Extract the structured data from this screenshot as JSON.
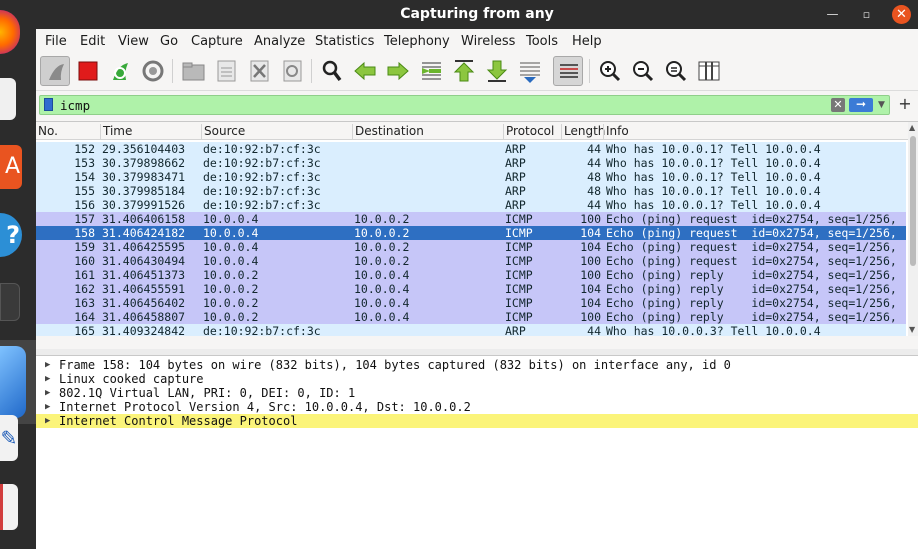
{
  "window": {
    "title": "Capturing from any"
  },
  "menu": [
    "File",
    "Edit",
    "View",
    "Go",
    "Capture",
    "Analyze",
    "Statistics",
    "Telephony",
    "Wireless",
    "Tools",
    "Help"
  ],
  "toolbar": {
    "icons": [
      "shark-fin-start-icon",
      "stop-capture-icon",
      "restart-capture-icon",
      "capture-options-icon",
      "open-file-icon",
      "save-file-icon",
      "close-file-icon",
      "reload-file-icon",
      "find-packet-icon",
      "go-back-icon",
      "go-forward-icon",
      "go-to-packet-icon",
      "go-first-packet-icon",
      "go-last-packet-icon",
      "autoscroll-icon",
      "colorize-icon",
      "zoom-in-icon",
      "zoom-out-icon",
      "normal-size-icon",
      "resize-columns-icon"
    ]
  },
  "filter": {
    "value": "icmp"
  },
  "columns": [
    "No.",
    "Time",
    "Source",
    "Destination",
    "Protocol",
    "Length",
    "Info"
  ],
  "packets": [
    {
      "no": "152",
      "time": "29.356104403",
      "src": "de:10:92:b7:cf:3c",
      "dst": "",
      "proto": "ARP",
      "len": "44",
      "info": "Who has 10.0.0.1? Tell 10.0.0.4",
      "kind": "arp"
    },
    {
      "no": "153",
      "time": "30.379898662",
      "src": "de:10:92:b7:cf:3c",
      "dst": "",
      "proto": "ARP",
      "len": "44",
      "info": "Who has 10.0.0.1? Tell 10.0.0.4",
      "kind": "arp"
    },
    {
      "no": "154",
      "time": "30.379983471",
      "src": "de:10:92:b7:cf:3c",
      "dst": "",
      "proto": "ARP",
      "len": "48",
      "info": "Who has 10.0.0.1? Tell 10.0.0.4",
      "kind": "arp"
    },
    {
      "no": "155",
      "time": "30.379985184",
      "src": "de:10:92:b7:cf:3c",
      "dst": "",
      "proto": "ARP",
      "len": "48",
      "info": "Who has 10.0.0.1? Tell 10.0.0.4",
      "kind": "arp"
    },
    {
      "no": "156",
      "time": "30.379991526",
      "src": "de:10:92:b7:cf:3c",
      "dst": "",
      "proto": "ARP",
      "len": "44",
      "info": "Who has 10.0.0.1? Tell 10.0.0.4",
      "kind": "arp"
    },
    {
      "no": "157",
      "time": "31.406406158",
      "src": "10.0.0.4",
      "dst": "10.0.0.2",
      "proto": "ICMP",
      "len": "100",
      "info": "Echo (ping) request  id=0x2754, seq=1/256,",
      "kind": "icmp"
    },
    {
      "no": "158",
      "time": "31.406424182",
      "src": "10.0.0.4",
      "dst": "10.0.0.2",
      "proto": "ICMP",
      "len": "104",
      "info": "Echo (ping) request  id=0x2754, seq=1/256,",
      "kind": "sel"
    },
    {
      "no": "159",
      "time": "31.406425595",
      "src": "10.0.0.4",
      "dst": "10.0.0.2",
      "proto": "ICMP",
      "len": "104",
      "info": "Echo (ping) request  id=0x2754, seq=1/256,",
      "kind": "icmp"
    },
    {
      "no": "160",
      "time": "31.406430494",
      "src": "10.0.0.4",
      "dst": "10.0.0.2",
      "proto": "ICMP",
      "len": "100",
      "info": "Echo (ping) request  id=0x2754, seq=1/256,",
      "kind": "icmp"
    },
    {
      "no": "161",
      "time": "31.406451373",
      "src": "10.0.0.2",
      "dst": "10.0.0.4",
      "proto": "ICMP",
      "len": "100",
      "info": "Echo (ping) reply    id=0x2754, seq=1/256,",
      "kind": "icmp"
    },
    {
      "no": "162",
      "time": "31.406455591",
      "src": "10.0.0.2",
      "dst": "10.0.0.4",
      "proto": "ICMP",
      "len": "104",
      "info": "Echo (ping) reply    id=0x2754, seq=1/256,",
      "kind": "icmp"
    },
    {
      "no": "163",
      "time": "31.406456402",
      "src": "10.0.0.2",
      "dst": "10.0.0.4",
      "proto": "ICMP",
      "len": "104",
      "info": "Echo (ping) reply    id=0x2754, seq=1/256,",
      "kind": "icmp"
    },
    {
      "no": "164",
      "time": "31.406458807",
      "src": "10.0.0.2",
      "dst": "10.0.0.4",
      "proto": "ICMP",
      "len": "100",
      "info": "Echo (ping) reply    id=0x2754, seq=1/256,",
      "kind": "icmp"
    },
    {
      "no": "165",
      "time": "31.409324842",
      "src": "de:10:92:b7:cf:3c",
      "dst": "",
      "proto": "ARP",
      "len": "44",
      "info": "Who has 10.0.0.3? Tell 10.0.0.4",
      "kind": "arp"
    }
  ],
  "details": [
    {
      "text": "Frame 158: 104 bytes on wire (832 bits), 104 bytes captured (832 bits) on interface any, id 0",
      "highlight": false
    },
    {
      "text": "Linux cooked capture",
      "highlight": false
    },
    {
      "text": "802.1Q Virtual LAN, PRI: 0, DEI: 0, ID: 1",
      "highlight": false
    },
    {
      "text": "Internet Protocol Version 4, Src: 10.0.0.4, Dst: 10.0.0.2",
      "highlight": false
    },
    {
      "text": "Internet Control Message Protocol",
      "highlight": true
    }
  ],
  "colors": {
    "arp_row": "#daeefe",
    "icmp_row": "#c6c6f8",
    "selected_row": "#2e6fc2",
    "filter_valid": "#aff2a9",
    "highlight": "#fbf47a"
  }
}
